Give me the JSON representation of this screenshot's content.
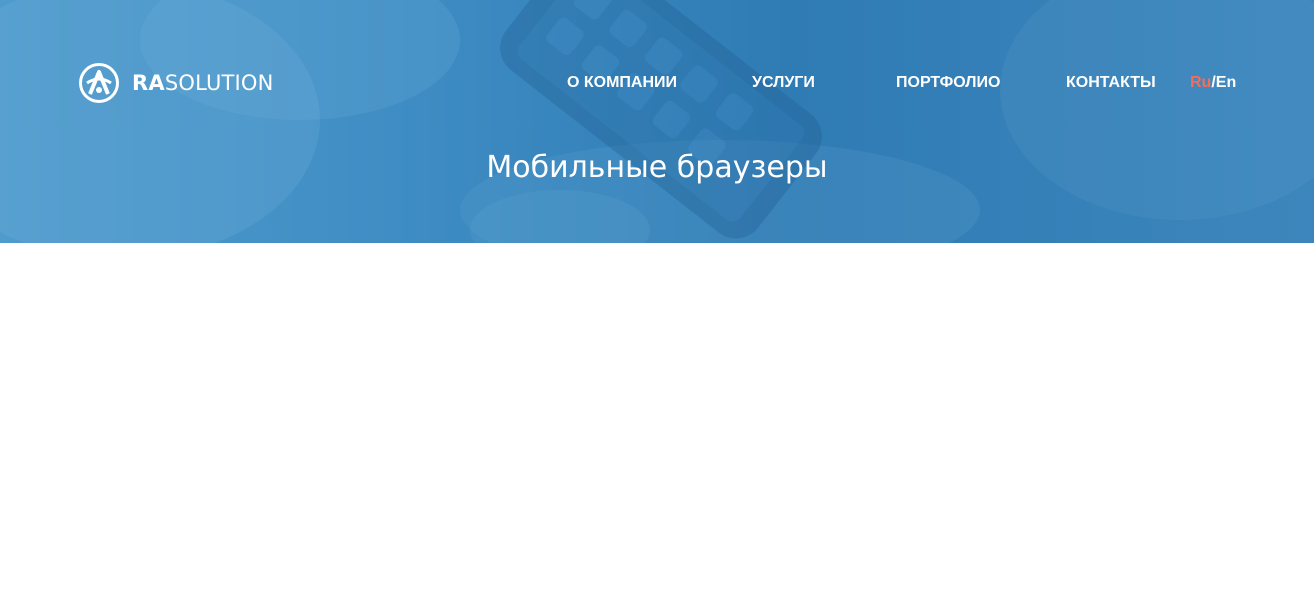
{
  "brand": {
    "name_bold": "RA",
    "name_rest": "SOLUTION"
  },
  "nav": {
    "items": [
      {
        "label": "О КОМПАНИИ"
      },
      {
        "label": "УСЛУГИ"
      },
      {
        "label": "ПОРТФОЛИО"
      },
      {
        "label": "КОНТАКТЫ"
      }
    ]
  },
  "lang": {
    "ru": "Ru",
    "separator": "/",
    "en": "En",
    "active": "Ru"
  },
  "page": {
    "title": "Мобильные браузеры"
  },
  "colors": {
    "hero_blue": "#2f7bb4",
    "accent": "#f26d5b",
    "text_body": "#6e6e6e"
  },
  "icons": {
    "logo": "ra-solution-logo-icon"
  }
}
